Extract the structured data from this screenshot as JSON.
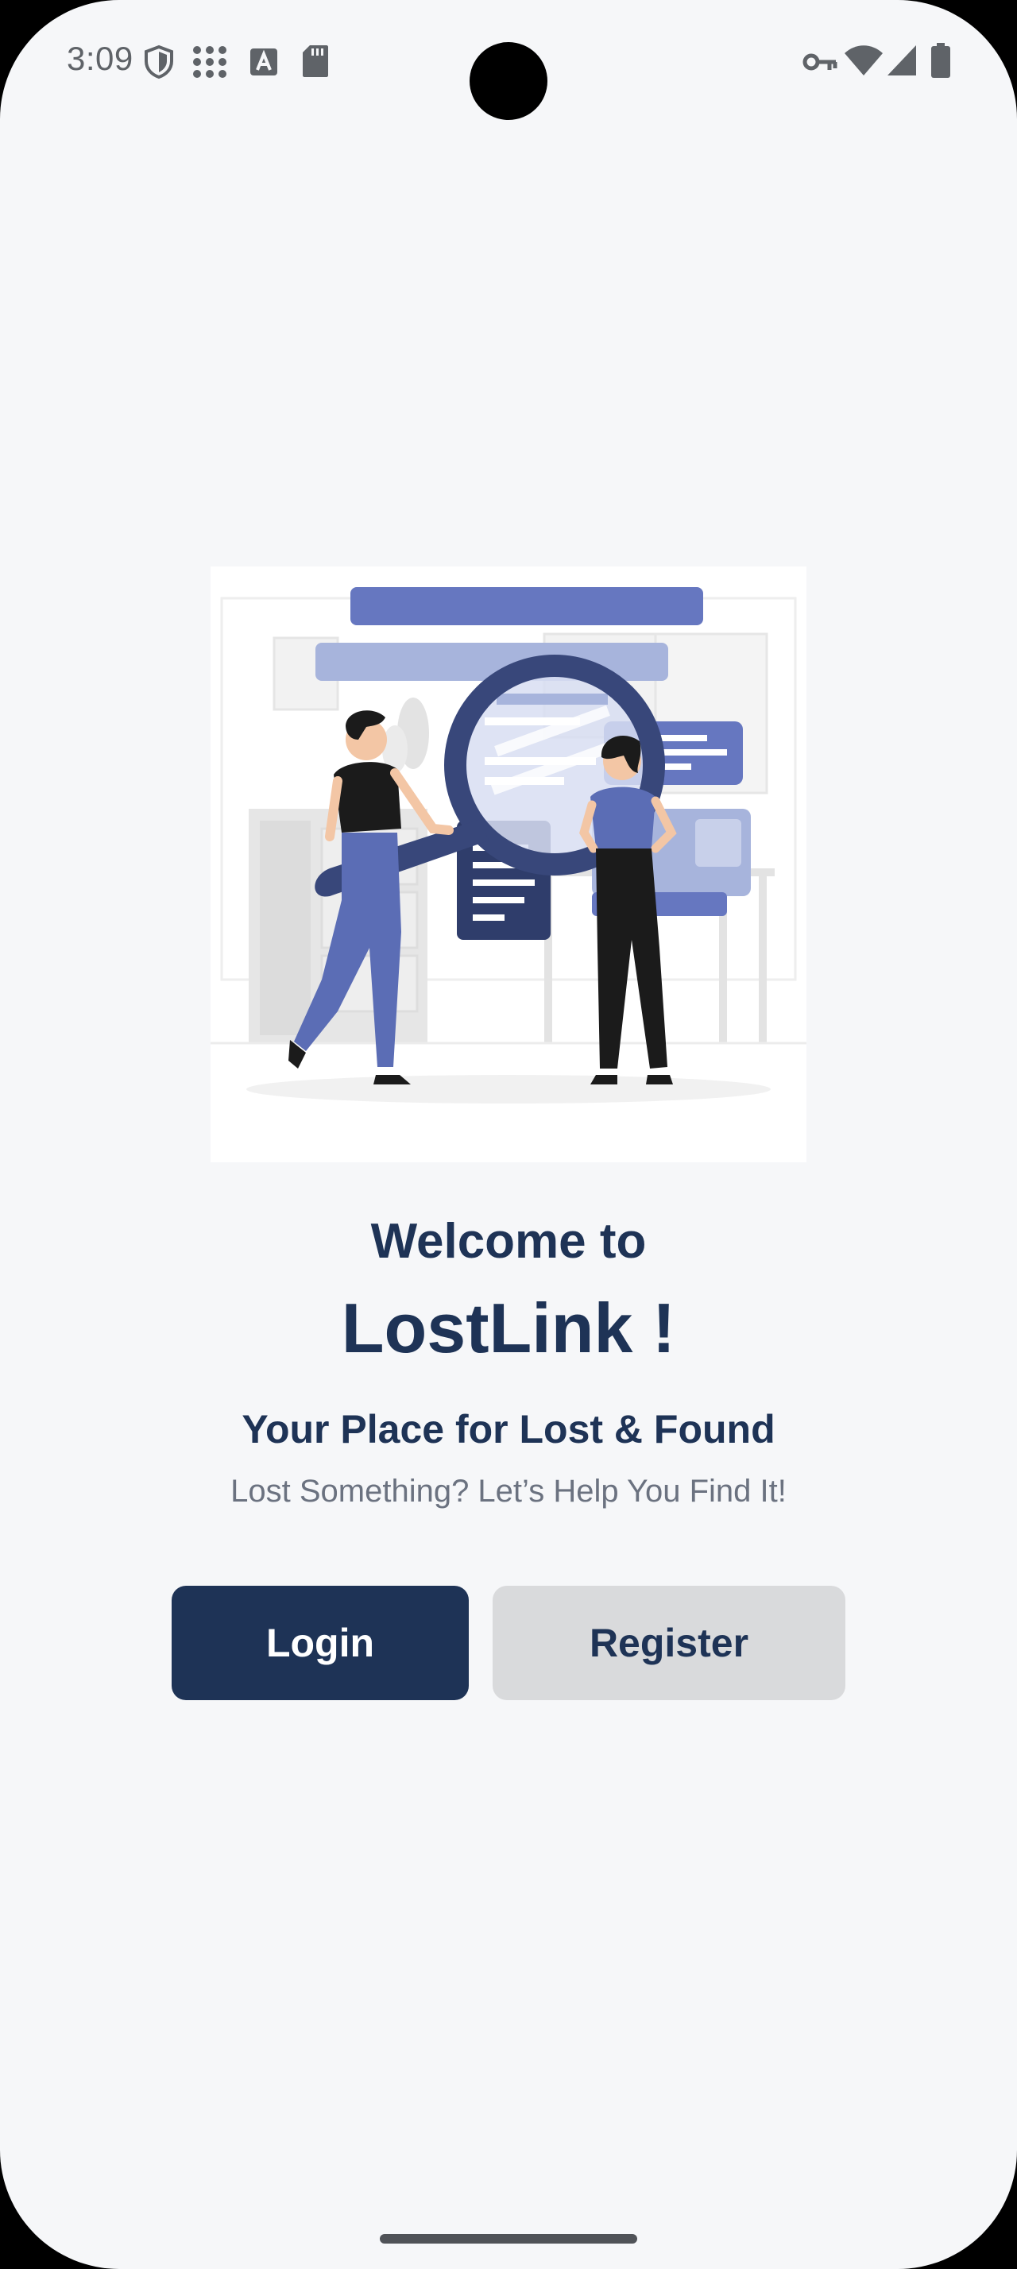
{
  "status_bar": {
    "time": "3:09",
    "left_icons": [
      "shield-icon",
      "dots-grid-icon",
      "font-a-icon",
      "sd-card-icon"
    ],
    "right_icons": [
      "key-icon",
      "wifi-icon",
      "cell-signal-icon",
      "battery-icon"
    ]
  },
  "hero": {
    "illustration": "lost-and-found-search-illustration"
  },
  "welcome": {
    "line1": "Welcome to",
    "app_name": "LostLink !",
    "tagline": "Your Place for Lost & Found",
    "subtitle": "Lost Something? Let’s Help You Find It!"
  },
  "actions": {
    "login_label": "Login",
    "register_label": "Register"
  },
  "colors": {
    "primary": "#1e3356",
    "secondary_button": "#d9dadc",
    "background": "#f6f7f9",
    "accent": "#5b6db5"
  }
}
